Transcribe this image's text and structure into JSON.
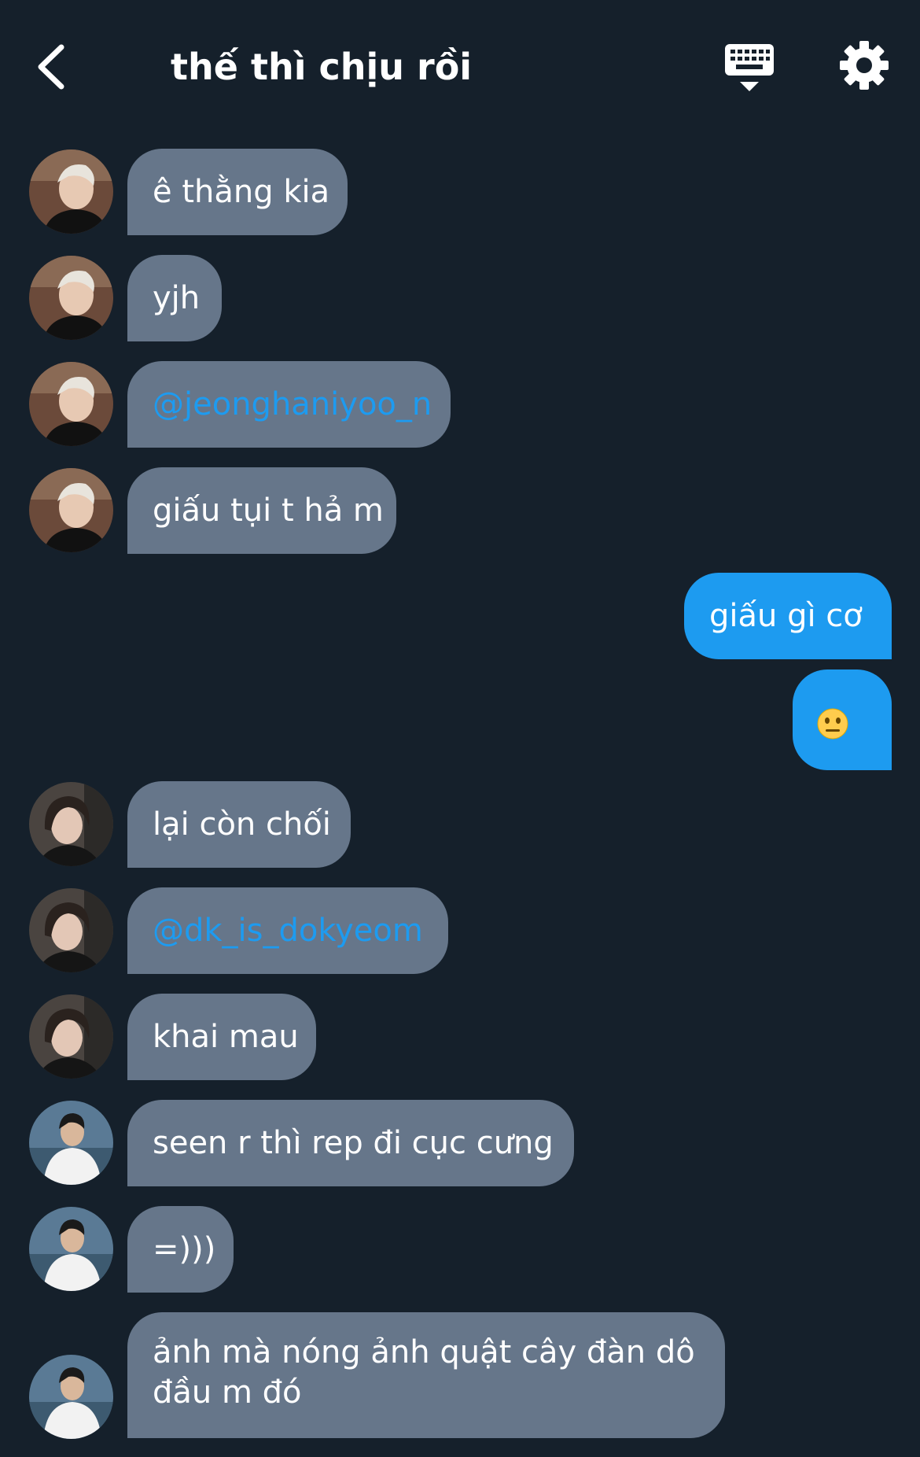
{
  "header": {
    "title": "thế thì chịu rồi"
  },
  "messages": [
    {
      "text": "ê thằng kia"
    },
    {
      "text": "yjh"
    },
    {
      "text": "@jeonghaniyoo_n"
    },
    {
      "text": "giấu tụi t hả m"
    },
    {
      "text": "giấu gì cơ"
    },
    {
      "text": "😐"
    },
    {
      "text": "lại còn chối"
    },
    {
      "text": "@dk_is_dokyeom"
    },
    {
      "text": "khai mau"
    },
    {
      "text": "seen r thì rep đi cục cưng"
    },
    {
      "text": "=)))"
    },
    {
      "text": "ảnh mà nóng ảnh quật cây đàn dô",
      "text2": "đầu m đó"
    }
  ],
  "colors": {
    "background": "#15202b",
    "incoming_bubble": "#66768a",
    "outgoing_bubble": "#1d9bf0",
    "mention": "#1d9bf0"
  }
}
